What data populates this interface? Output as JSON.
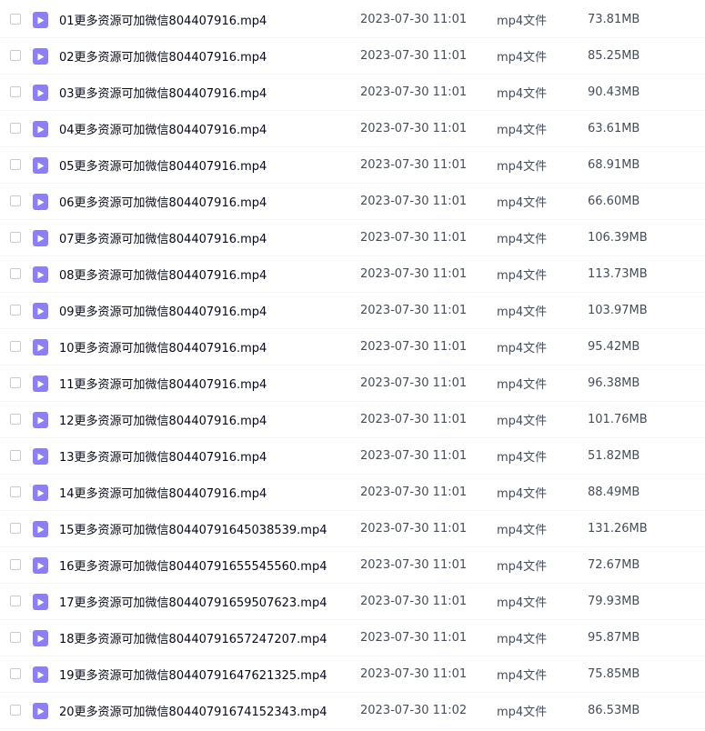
{
  "file_icon": "video-file-icon",
  "colors": {
    "icon_bg": "#8b7ff3"
  },
  "files": [
    {
      "name": "01更多资源可加微信804407916.mp4",
      "date": "2023-07-30 11:01",
      "type": "mp4文件",
      "size": "73.81MB"
    },
    {
      "name": "02更多资源可加微信804407916.mp4",
      "date": "2023-07-30 11:01",
      "type": "mp4文件",
      "size": "85.25MB"
    },
    {
      "name": "03更多资源可加微信804407916.mp4",
      "date": "2023-07-30 11:01",
      "type": "mp4文件",
      "size": "90.43MB"
    },
    {
      "name": "04更多资源可加微信804407916.mp4",
      "date": "2023-07-30 11:01",
      "type": "mp4文件",
      "size": "63.61MB"
    },
    {
      "name": "05更多资源可加微信804407916.mp4",
      "date": "2023-07-30 11:01",
      "type": "mp4文件",
      "size": "68.91MB"
    },
    {
      "name": "06更多资源可加微信804407916.mp4",
      "date": "2023-07-30 11:01",
      "type": "mp4文件",
      "size": "66.60MB"
    },
    {
      "name": "07更多资源可加微信804407916.mp4",
      "date": "2023-07-30 11:01",
      "type": "mp4文件",
      "size": "106.39MB"
    },
    {
      "name": "08更多资源可加微信804407916.mp4",
      "date": "2023-07-30 11:01",
      "type": "mp4文件",
      "size": "113.73MB"
    },
    {
      "name": "09更多资源可加微信804407916.mp4",
      "date": "2023-07-30 11:01",
      "type": "mp4文件",
      "size": "103.97MB"
    },
    {
      "name": "10更多资源可加微信804407916.mp4",
      "date": "2023-07-30 11:01",
      "type": "mp4文件",
      "size": "95.42MB"
    },
    {
      "name": "11更多资源可加微信804407916.mp4",
      "date": "2023-07-30 11:01",
      "type": "mp4文件",
      "size": "96.38MB"
    },
    {
      "name": "12更多资源可加微信804407916.mp4",
      "date": "2023-07-30 11:01",
      "type": "mp4文件",
      "size": "101.76MB"
    },
    {
      "name": "13更多资源可加微信804407916.mp4",
      "date": "2023-07-30 11:01",
      "type": "mp4文件",
      "size": "51.82MB"
    },
    {
      "name": "14更多资源可加微信804407916.mp4",
      "date": "2023-07-30 11:01",
      "type": "mp4文件",
      "size": "88.49MB"
    },
    {
      "name": "15更多资源可加微信80440791645038539.mp4",
      "date": "2023-07-30 11:01",
      "type": "mp4文件",
      "size": "131.26MB"
    },
    {
      "name": "16更多资源可加微信80440791655545560.mp4",
      "date": "2023-07-30 11:01",
      "type": "mp4文件",
      "size": "72.67MB"
    },
    {
      "name": "17更多资源可加微信80440791659507623.mp4",
      "date": "2023-07-30 11:01",
      "type": "mp4文件",
      "size": "79.93MB"
    },
    {
      "name": "18更多资源可加微信80440791657247207.mp4",
      "date": "2023-07-30 11:01",
      "type": "mp4文件",
      "size": "95.87MB"
    },
    {
      "name": "19更多资源可加微信80440791647621325.mp4",
      "date": "2023-07-30 11:01",
      "type": "mp4文件",
      "size": "75.85MB"
    },
    {
      "name": "20更多资源可加微信80440791674152343.mp4",
      "date": "2023-07-30 11:02",
      "type": "mp4文件",
      "size": "86.53MB"
    }
  ]
}
